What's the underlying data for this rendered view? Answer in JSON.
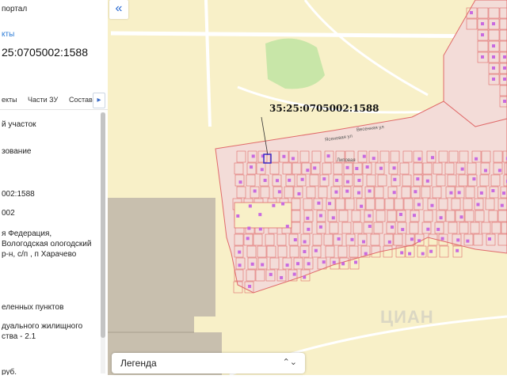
{
  "panel": {
    "portal_title": "портал",
    "objects_link": "кты",
    "cadastral_number": "25:0705002:1588",
    "tabs": [
      {
        "label": "екты"
      },
      {
        "label": "Части ЗУ"
      },
      {
        "label": "Состав"
      }
    ],
    "tabs_next": "▸",
    "fields": [
      {
        "value": "й участок"
      },
      {
        "value": "зование"
      },
      {
        "value": "002:1588"
      },
      {
        "value": "002"
      },
      {
        "value": "я Федерация, Вологодская ологодский р-н, с/п , п Харачево"
      },
      {
        "value": "еленных пунктов"
      },
      {
        "value": "дуального жилищного ства - 2.1"
      },
      {
        "value": "руб."
      }
    ]
  },
  "controls": {
    "collapse_icon": "«",
    "legend_label": "Легенда",
    "legend_chevron": "⌃⌄"
  },
  "map": {
    "parcel_label": "35:25:0705002:1588",
    "street_1": "Ясеновая ул",
    "street_2": "Весенняя ул",
    "street_3": "Липовая",
    "watermark": "ЦИАН",
    "colors": {
      "background": "#f8f0c8",
      "settlement": "#f3dcd8",
      "parcel_stroke": "#e06a6a",
      "building": "#c86ae0",
      "park": "#c8e6a8",
      "brown_area": "#c8bfae",
      "selected_outline": "#3a2cc8"
    }
  }
}
